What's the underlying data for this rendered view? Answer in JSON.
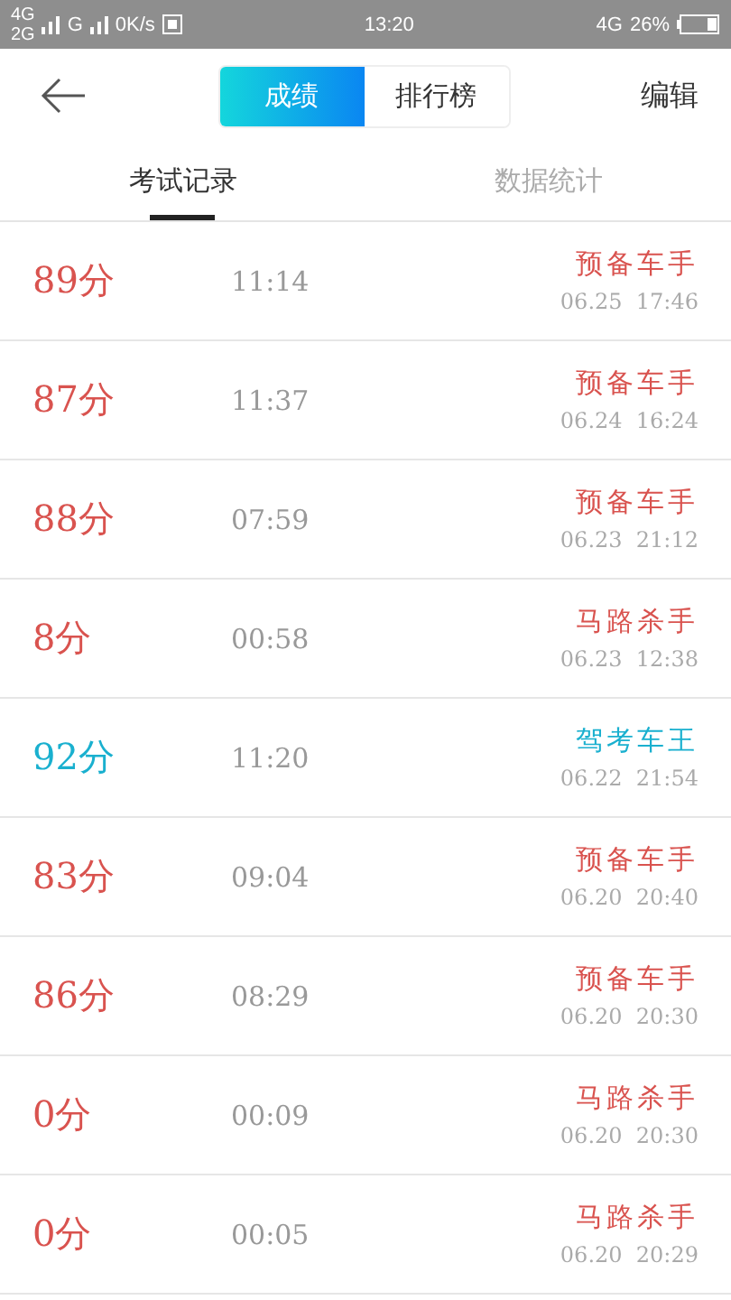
{
  "status_bar": {
    "network_1": "4G",
    "network_2": "2G",
    "network_3": "G",
    "speed": "0K/s",
    "time": "13:20",
    "network_4": "4G",
    "battery": "26%"
  },
  "nav": {
    "segments": [
      {
        "label": "成绩",
        "selected": true
      },
      {
        "label": "排行榜",
        "selected": false
      }
    ],
    "action": "编辑"
  },
  "tabs": [
    {
      "label": "考试记录",
      "selected": true
    },
    {
      "label": "数据统计",
      "selected": false
    }
  ],
  "records": [
    {
      "score": "89分",
      "duration": "11:14",
      "title": "预备车手",
      "date": "06.25  17:46",
      "color": "#d9534f"
    },
    {
      "score": "87分",
      "duration": "11:37",
      "title": "预备车手",
      "date": "06.24  16:24",
      "color": "#d9534f"
    },
    {
      "score": "88分",
      "duration": "07:59",
      "title": "预备车手",
      "date": "06.23  21:12",
      "color": "#d9534f"
    },
    {
      "score": "8分",
      "duration": "00:58",
      "title": "马路杀手",
      "date": "06.23  12:38",
      "color": "#d9534f"
    },
    {
      "score": "92分",
      "duration": "11:20",
      "title": "驾考车王",
      "date": "06.22  21:54",
      "color": "#1ab0cf"
    },
    {
      "score": "83分",
      "duration": "09:04",
      "title": "预备车手",
      "date": "06.20  20:40",
      "color": "#d9534f"
    },
    {
      "score": "86分",
      "duration": "08:29",
      "title": "预备车手",
      "date": "06.20  20:30",
      "color": "#d9534f"
    },
    {
      "score": "0分",
      "duration": "00:09",
      "title": "马路杀手",
      "date": "06.20  20:30",
      "color": "#d9534f"
    },
    {
      "score": "0分",
      "duration": "00:05",
      "title": "马路杀手",
      "date": "06.20  20:29",
      "color": "#d9534f"
    }
  ]
}
